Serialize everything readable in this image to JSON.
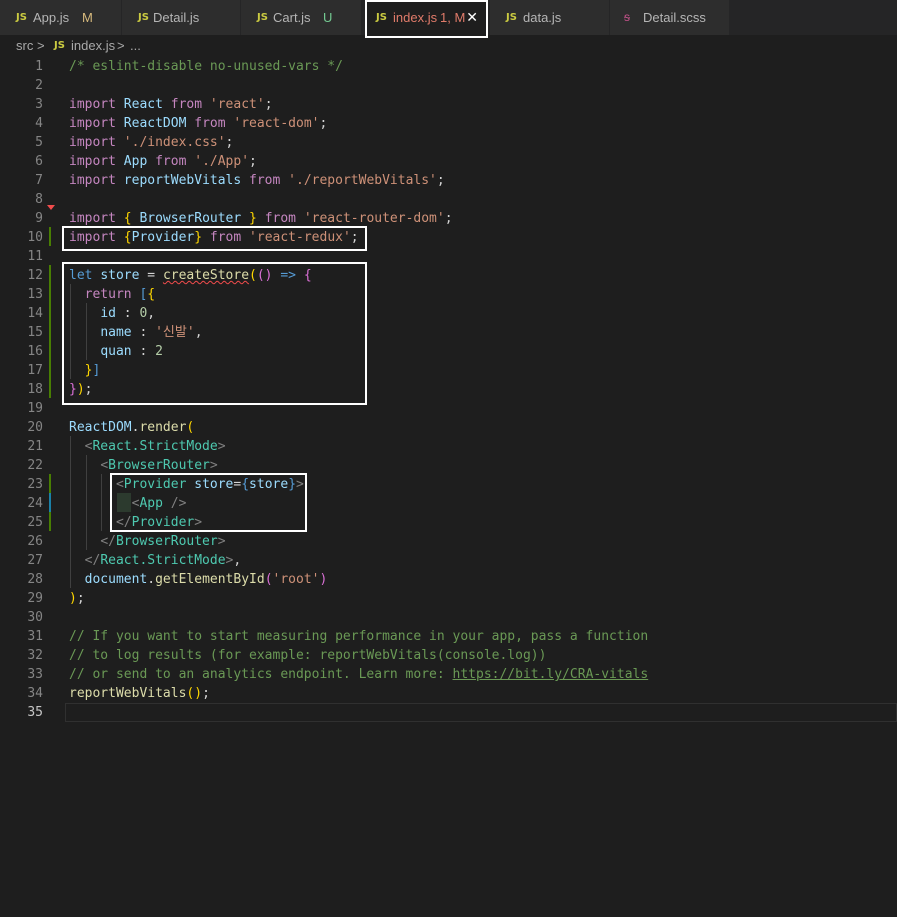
{
  "tabs": [
    {
      "icon": "JS",
      "name": "App.js",
      "status": "M"
    },
    {
      "icon": "JS",
      "name": "Detail.js",
      "status": ""
    },
    {
      "icon": "JS",
      "name": "Cart.js",
      "status": "U"
    },
    {
      "icon": "JS",
      "name": "index.js",
      "status": "1, M",
      "close": "✕"
    },
    {
      "icon": "JS",
      "name": "data.js",
      "status": ""
    },
    {
      "icon": "sass",
      "name": "Detail.scss",
      "status": ""
    }
  ],
  "breadcrumb": {
    "folder": "src",
    "sep": ">",
    "icon": "JS",
    "file": "index.js",
    "sep2": ">",
    "rest": "..."
  },
  "lines": [
    {
      "n": "1",
      "tokens": [
        [
          "c",
          "/* eslint-disable no-unused-vars */"
        ]
      ]
    },
    {
      "n": "2",
      "tokens": []
    },
    {
      "n": "3",
      "tokens": [
        [
          "k",
          "import"
        ],
        [
          "o",
          " "
        ],
        [
          "v",
          "React"
        ],
        [
          "o",
          " "
        ],
        [
          "k",
          "from"
        ],
        [
          "o",
          " "
        ],
        [
          "s",
          "'react'"
        ],
        [
          "o",
          ";"
        ]
      ]
    },
    {
      "n": "4",
      "tokens": [
        [
          "k",
          "import"
        ],
        [
          "o",
          " "
        ],
        [
          "v",
          "ReactDOM"
        ],
        [
          "o",
          " "
        ],
        [
          "k",
          "from"
        ],
        [
          "o",
          " "
        ],
        [
          "s",
          "'react-dom'"
        ],
        [
          "o",
          ";"
        ]
      ]
    },
    {
      "n": "5",
      "tokens": [
        [
          "k",
          "import"
        ],
        [
          "o",
          " "
        ],
        [
          "s",
          "'./index.css'"
        ],
        [
          "o",
          ";"
        ]
      ]
    },
    {
      "n": "6",
      "tokens": [
        [
          "k",
          "import"
        ],
        [
          "o",
          " "
        ],
        [
          "v",
          "App"
        ],
        [
          "o",
          " "
        ],
        [
          "k",
          "from"
        ],
        [
          "o",
          " "
        ],
        [
          "s",
          "'./App'"
        ],
        [
          "o",
          ";"
        ]
      ]
    },
    {
      "n": "7",
      "tokens": [
        [
          "k",
          "import"
        ],
        [
          "o",
          " "
        ],
        [
          "v",
          "reportWebVitals"
        ],
        [
          "o",
          " "
        ],
        [
          "k",
          "from"
        ],
        [
          "o",
          " "
        ],
        [
          "s",
          "'./reportWebVitals'"
        ],
        [
          "o",
          ";"
        ]
      ]
    },
    {
      "n": "8",
      "tokens": []
    },
    {
      "n": "9",
      "tokens": [
        [
          "k",
          "import"
        ],
        [
          "o",
          " "
        ],
        [
          "y",
          "{"
        ],
        [
          "o",
          " "
        ],
        [
          "v",
          "BrowserRouter"
        ],
        [
          "o",
          " "
        ],
        [
          "y",
          "}"
        ],
        [
          "o",
          " "
        ],
        [
          "k",
          "from"
        ],
        [
          "o",
          " "
        ],
        [
          "s",
          "'react-router-dom'"
        ],
        [
          "o",
          ";"
        ]
      ]
    },
    {
      "n": "10",
      "tokens": [
        [
          "k",
          "import"
        ],
        [
          "o",
          " "
        ],
        [
          "y",
          "{"
        ],
        [
          "v",
          "Provider"
        ],
        [
          "y",
          "}"
        ],
        [
          "o",
          " "
        ],
        [
          "k",
          "from"
        ],
        [
          "o",
          " "
        ],
        [
          "s",
          "'react-redux'"
        ],
        [
          "o",
          ";"
        ]
      ]
    },
    {
      "n": "11",
      "tokens": []
    },
    {
      "n": "12",
      "tokens": [
        [
          "b",
          "let"
        ],
        [
          "o",
          " "
        ],
        [
          "v",
          "store"
        ],
        [
          "o",
          " = "
        ],
        [
          "fsq",
          "createStore"
        ],
        [
          "y",
          "("
        ],
        [
          "m",
          "()"
        ],
        [
          "o",
          " "
        ],
        [
          "b",
          "=>"
        ],
        [
          "o",
          " "
        ],
        [
          "m",
          "{"
        ]
      ]
    },
    {
      "n": "13",
      "tokens": [
        [
          "o",
          "  "
        ],
        [
          "k",
          "return"
        ],
        [
          "o",
          " "
        ],
        [
          "b",
          "["
        ],
        [
          "y",
          "{"
        ]
      ]
    },
    {
      "n": "14",
      "tokens": [
        [
          "o",
          "    "
        ],
        [
          "v",
          "id"
        ],
        [
          "o",
          " : "
        ],
        [
          "n",
          "0"
        ],
        [
          "o",
          ","
        ]
      ]
    },
    {
      "n": "15",
      "tokens": [
        [
          "o",
          "    "
        ],
        [
          "v",
          "name"
        ],
        [
          "o",
          " : "
        ],
        [
          "s",
          "'신발'"
        ],
        [
          "o",
          ","
        ]
      ]
    },
    {
      "n": "16",
      "tokens": [
        [
          "o",
          "    "
        ],
        [
          "v",
          "quan"
        ],
        [
          "o",
          " : "
        ],
        [
          "n",
          "2"
        ]
      ]
    },
    {
      "n": "17",
      "tokens": [
        [
          "o",
          "  "
        ],
        [
          "y",
          "}"
        ],
        [
          "b",
          "]"
        ]
      ]
    },
    {
      "n": "18",
      "tokens": [
        [
          "m",
          "}"
        ],
        [
          "y",
          ")"
        ],
        [
          "o",
          ";"
        ]
      ]
    },
    {
      "n": "19",
      "tokens": []
    },
    {
      "n": "20",
      "tokens": [
        [
          "v",
          "ReactDOM"
        ],
        [
          "o",
          "."
        ],
        [
          "f",
          "render"
        ],
        [
          "y",
          "("
        ]
      ]
    },
    {
      "n": "21",
      "tokens": [
        [
          "o",
          "  "
        ],
        [
          "p",
          "<"
        ],
        [
          "t",
          "React.StrictMode"
        ],
        [
          "p",
          ">"
        ]
      ]
    },
    {
      "n": "22",
      "tokens": [
        [
          "o",
          "    "
        ],
        [
          "p",
          "<"
        ],
        [
          "t",
          "BrowserRouter"
        ],
        [
          "p",
          ">"
        ]
      ]
    },
    {
      "n": "23",
      "tokens": [
        [
          "o",
          "      "
        ],
        [
          "p",
          "<"
        ],
        [
          "t",
          "Provider"
        ],
        [
          "o",
          " "
        ],
        [
          "v",
          "store"
        ],
        [
          "o",
          "="
        ],
        [
          "b",
          "{"
        ],
        [
          "v",
          "store"
        ],
        [
          "b",
          "}"
        ],
        [
          "p",
          ">"
        ]
      ]
    },
    {
      "n": "24",
      "tokens": [
        [
          "o",
          "        "
        ],
        [
          "p",
          "<"
        ],
        [
          "t",
          "App"
        ],
        [
          "o",
          " "
        ],
        [
          "p",
          "/>"
        ]
      ]
    },
    {
      "n": "25",
      "tokens": [
        [
          "o",
          "      "
        ],
        [
          "p",
          "</"
        ],
        [
          "t",
          "Provider"
        ],
        [
          "p",
          ">"
        ]
      ]
    },
    {
      "n": "26",
      "tokens": [
        [
          "o",
          "    "
        ],
        [
          "p",
          "</"
        ],
        [
          "t",
          "BrowserRouter"
        ],
        [
          "p",
          ">"
        ]
      ]
    },
    {
      "n": "27",
      "tokens": [
        [
          "o",
          "  "
        ],
        [
          "p",
          "</"
        ],
        [
          "t",
          "React.StrictMode"
        ],
        [
          "p",
          ">"
        ],
        [
          "o",
          ","
        ]
      ]
    },
    {
      "n": "28",
      "tokens": [
        [
          "o",
          "  "
        ],
        [
          "v",
          "document"
        ],
        [
          "o",
          "."
        ],
        [
          "f",
          "getElementById"
        ],
        [
          "m",
          "("
        ],
        [
          "s",
          "'root'"
        ],
        [
          "m",
          ")"
        ]
      ]
    },
    {
      "n": "29",
      "tokens": [
        [
          "y",
          ")"
        ],
        [
          "o",
          ";"
        ]
      ]
    },
    {
      "n": "30",
      "tokens": []
    },
    {
      "n": "31",
      "tokens": [
        [
          "c",
          "// If you want to start measuring performance in your app, pass a function"
        ]
      ]
    },
    {
      "n": "32",
      "tokens": [
        [
          "c",
          "// to log results (for example: reportWebVitals(console.log))"
        ]
      ]
    },
    {
      "n": "33",
      "tokens": [
        [
          "c",
          "// or send to an analytics endpoint. Learn more: "
        ],
        [
          "cu",
          "https://bit.ly/CRA-vitals"
        ]
      ]
    },
    {
      "n": "34",
      "tokens": [
        [
          "f",
          "reportWebVitals"
        ],
        [
          "y",
          "()"
        ],
        [
          "o",
          ";"
        ]
      ]
    },
    {
      "n": "35",
      "tokens": []
    }
  ],
  "colors": {
    "background": "#1e1e1e",
    "keyword": "#c586c0",
    "string": "#ce9178",
    "comment": "#6a9955",
    "tag": "#4ec9b0"
  }
}
